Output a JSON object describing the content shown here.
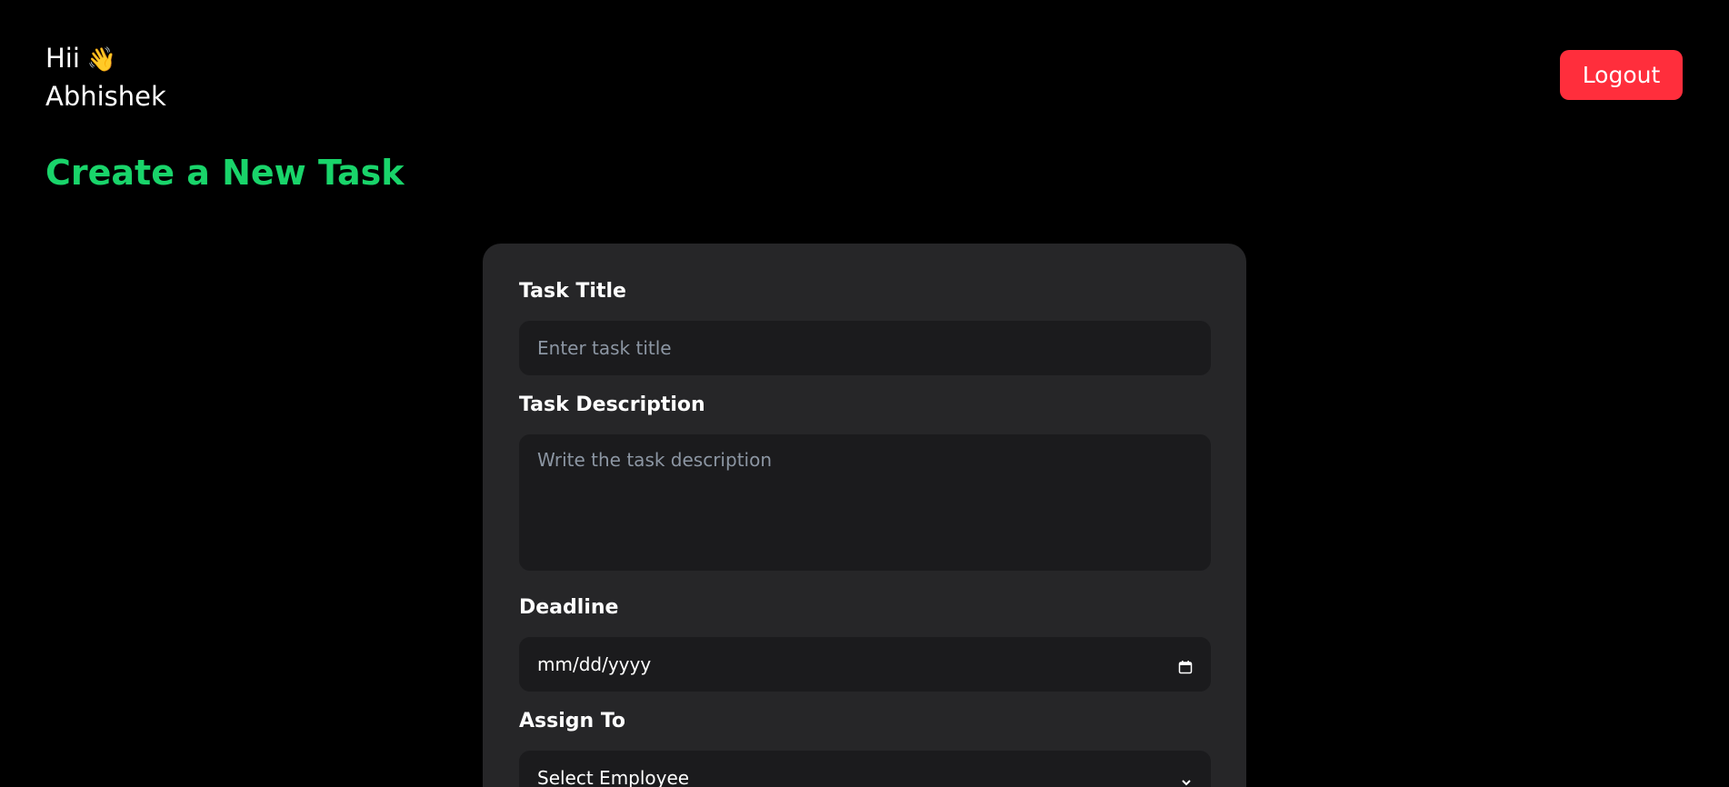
{
  "header": {
    "greeting": "Hii",
    "wave_emoji": "👋",
    "user_name": "Abhishek",
    "logout_label": "Logout"
  },
  "page": {
    "title": "Create a New Task"
  },
  "form": {
    "title_label": "Task Title",
    "title_placeholder": "Enter task title",
    "description_label": "Task Description",
    "description_placeholder": "Write the task description",
    "deadline_label": "Deadline",
    "deadline_value": "mm/dd/yyyy",
    "assign_label": "Assign To",
    "assign_value": "Select Employee"
  },
  "colors": {
    "background": "#000000",
    "accent_green": "#19d46a",
    "logout_red": "#ff2e3c",
    "card_bg": "#262628",
    "input_bg": "#1b1b1d"
  },
  "icons": {
    "wave": "waving-hand-icon",
    "calendar": "calendar-icon",
    "dropdown": "chevron-down-icon"
  }
}
